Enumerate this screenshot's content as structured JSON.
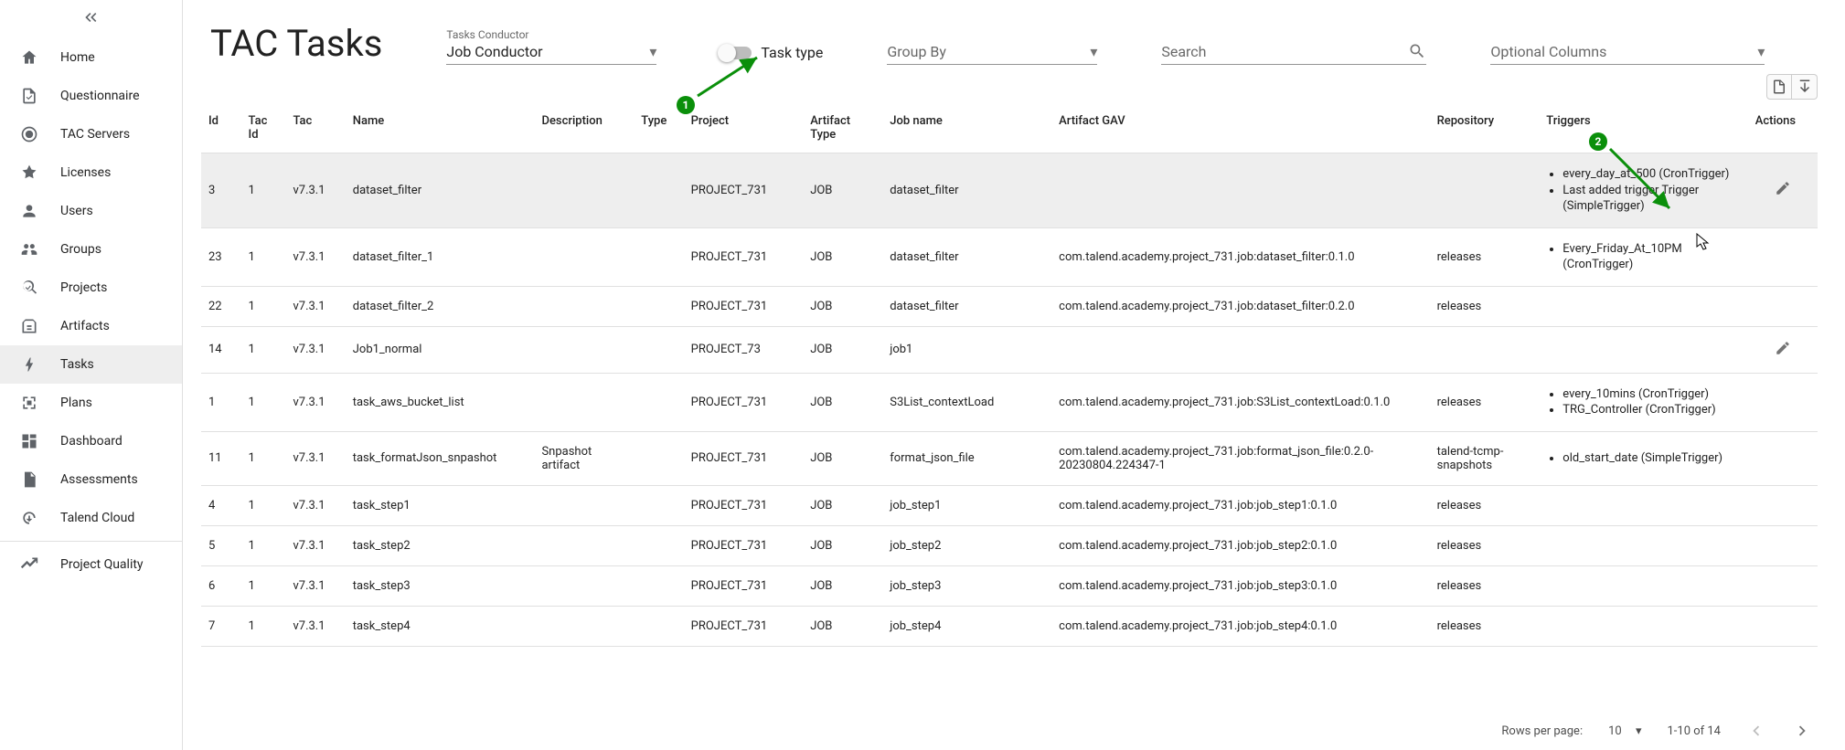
{
  "nav": [
    {
      "icon": "home",
      "label": "Home"
    },
    {
      "icon": "quest",
      "label": "Questionnaire"
    },
    {
      "icon": "server",
      "label": "TAC Servers"
    },
    {
      "icon": "license",
      "label": "Licenses"
    },
    {
      "icon": "user",
      "label": "Users"
    },
    {
      "icon": "group",
      "label": "Groups"
    },
    {
      "icon": "proj",
      "label": "Projects"
    },
    {
      "icon": "art",
      "label": "Artifacts"
    },
    {
      "icon": "task",
      "label": "Tasks",
      "active": true
    },
    {
      "icon": "plan",
      "label": "Plans"
    },
    {
      "icon": "dash",
      "label": "Dashboard"
    },
    {
      "icon": "assess",
      "label": "Assessments"
    },
    {
      "icon": "cloud",
      "label": "Talend Cloud"
    },
    {
      "icon": "quality",
      "label": "Project Quality",
      "divider": true
    }
  ],
  "page": {
    "title": "TAC Tasks"
  },
  "filters": {
    "tasksConductor": {
      "caption": "Tasks Conductor",
      "value": "Job Conductor"
    },
    "taskTypeToggle": {
      "label": "Task type"
    },
    "groupBy": {
      "value": "Group By"
    },
    "search": {
      "placeholder": "Search"
    },
    "optCols": {
      "value": "Optional Columns"
    }
  },
  "columns": [
    "Id",
    "Tac Id",
    "Tac",
    "Name",
    "Description",
    "Type",
    "Project",
    "Artifact Type",
    "Job name",
    "Artifact GAV",
    "Repository",
    "Triggers",
    "Actions"
  ],
  "rows": [
    {
      "id": "3",
      "tacId": "1",
      "tac": "v7.3.1",
      "name": "dataset_filter",
      "desc": "",
      "type": "",
      "project": "PROJECT_731",
      "artType": "JOB",
      "jobName": "dataset_filter",
      "gav": "",
      "repo": "",
      "triggers": [
        "every_day_at_500 (CronTrigger)",
        "Last added trigger Trigger (SimpleTrigger)"
      ],
      "edit": true,
      "highlight": true
    },
    {
      "id": "23",
      "tacId": "1",
      "tac": "v7.3.1",
      "name": "dataset_filter_1",
      "desc": "",
      "type": "",
      "project": "PROJECT_731",
      "artType": "JOB",
      "jobName": "dataset_filter",
      "gav": "com.talend.academy.project_731.job:dataset_filter:0.1.0",
      "repo": "releases",
      "triggers": [
        "Every_Friday_At_10PM (CronTrigger)"
      ]
    },
    {
      "id": "22",
      "tacId": "1",
      "tac": "v7.3.1",
      "name": "dataset_filter_2",
      "desc": "",
      "type": "",
      "project": "PROJECT_731",
      "artType": "JOB",
      "jobName": "dataset_filter",
      "gav": "com.talend.academy.project_731.job:dataset_filter:0.2.0",
      "repo": "releases",
      "triggers": []
    },
    {
      "id": "14",
      "tacId": "1",
      "tac": "v7.3.1",
      "name": "Job1_normal",
      "desc": "",
      "type": "",
      "project": "PROJECT_73",
      "artType": "JOB",
      "jobName": "job1",
      "gav": "",
      "repo": "",
      "triggers": [],
      "edit": true
    },
    {
      "id": "1",
      "tacId": "1",
      "tac": "v7.3.1",
      "name": "task_aws_bucket_list",
      "desc": "",
      "type": "",
      "project": "PROJECT_731",
      "artType": "JOB",
      "jobName": "S3List_contextLoad",
      "gav": "com.talend.academy.project_731.job:S3List_contextLoad:0.1.0",
      "repo": "releases",
      "triggers": [
        "every_10mins (CronTrigger)",
        "TRG_Controller (CronTrigger)"
      ]
    },
    {
      "id": "11",
      "tacId": "1",
      "tac": "v7.3.1",
      "name": "task_formatJson_snpashot",
      "desc": "Snpashot artifact",
      "type": "",
      "project": "PROJECT_731",
      "artType": "JOB",
      "jobName": "format_json_file",
      "gav": "com.talend.academy.project_731.job:format_json_file:0.2.0-20230804.224347-1",
      "repo": "talend-tcmp-snapshots",
      "triggers": [
        "old_start_date (SimpleTrigger)"
      ]
    },
    {
      "id": "4",
      "tacId": "1",
      "tac": "v7.3.1",
      "name": "task_step1",
      "desc": "",
      "type": "",
      "project": "PROJECT_731",
      "artType": "JOB",
      "jobName": "job_step1",
      "gav": "com.talend.academy.project_731.job:job_step1:0.1.0",
      "repo": "releases",
      "triggers": []
    },
    {
      "id": "5",
      "tacId": "1",
      "tac": "v7.3.1",
      "name": "task_step2",
      "desc": "",
      "type": "",
      "project": "PROJECT_731",
      "artType": "JOB",
      "jobName": "job_step2",
      "gav": "com.talend.academy.project_731.job:job_step2:0.1.0",
      "repo": "releases",
      "triggers": []
    },
    {
      "id": "6",
      "tacId": "1",
      "tac": "v7.3.1",
      "name": "task_step3",
      "desc": "",
      "type": "",
      "project": "PROJECT_731",
      "artType": "JOB",
      "jobName": "job_step3",
      "gav": "com.talend.academy.project_731.job:job_step3:0.1.0",
      "repo": "releases",
      "triggers": []
    },
    {
      "id": "7",
      "tacId": "1",
      "tac": "v7.3.1",
      "name": "task_step4",
      "desc": "",
      "type": "",
      "project": "PROJECT_731",
      "artType": "JOB",
      "jobName": "job_step4",
      "gav": "com.talend.academy.project_731.job:job_step4:0.1.0",
      "repo": "releases",
      "triggers": []
    }
  ],
  "pager": {
    "rppLabel": "Rows per page:",
    "rpp": "10",
    "range": "1-10 of 14"
  }
}
